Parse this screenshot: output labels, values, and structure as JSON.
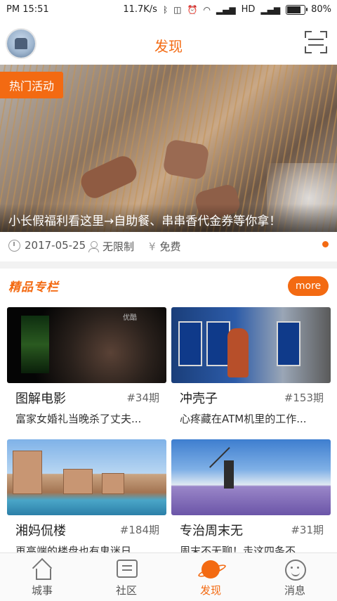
{
  "status_bar": {
    "time": "PM 15:51",
    "network_speed": "11.7K/s",
    "network_type": "HD",
    "battery": "80%",
    "battery_level": 0.8
  },
  "header": {
    "title": "发现"
  },
  "banner": {
    "tag": "热门活动",
    "caption": "小长假福利看这里→自助餐、串串香代金券等你拿！",
    "date": "2017-05-25",
    "limit": "无限制",
    "price": "免费",
    "currency_symbol": "¥"
  },
  "section": {
    "title": "精品专栏",
    "more_label": "more"
  },
  "cards": [
    {
      "name": "图解电影",
      "issue": "#34期",
      "desc": "富家女婚礼当晚杀了丈夫..."
    },
    {
      "name": "冲壳子",
      "issue": "#153期",
      "desc": "心疼藏在ATM机里的工作..."
    },
    {
      "name": "湘妈侃楼",
      "issue": "#184期",
      "desc": "再高端的楼盘也有鬼迷日..."
    },
    {
      "name": "专治周末无",
      "issue": "#31期",
      "desc": "周末不无聊！走这四条不..."
    }
  ],
  "image_overlays": {
    "movie_watermark": "优酷"
  },
  "bottom_nav": [
    {
      "label": "城事",
      "icon": "home-icon",
      "active": false
    },
    {
      "label": "社区",
      "icon": "chat-icon",
      "active": false
    },
    {
      "label": "发现",
      "icon": "planet-icon",
      "active": true
    },
    {
      "label": "消息",
      "icon": "smile-icon",
      "active": false
    }
  ],
  "colors": {
    "accent": "#f36a12",
    "text": "#222222",
    "divider": "#f2f2f2"
  }
}
